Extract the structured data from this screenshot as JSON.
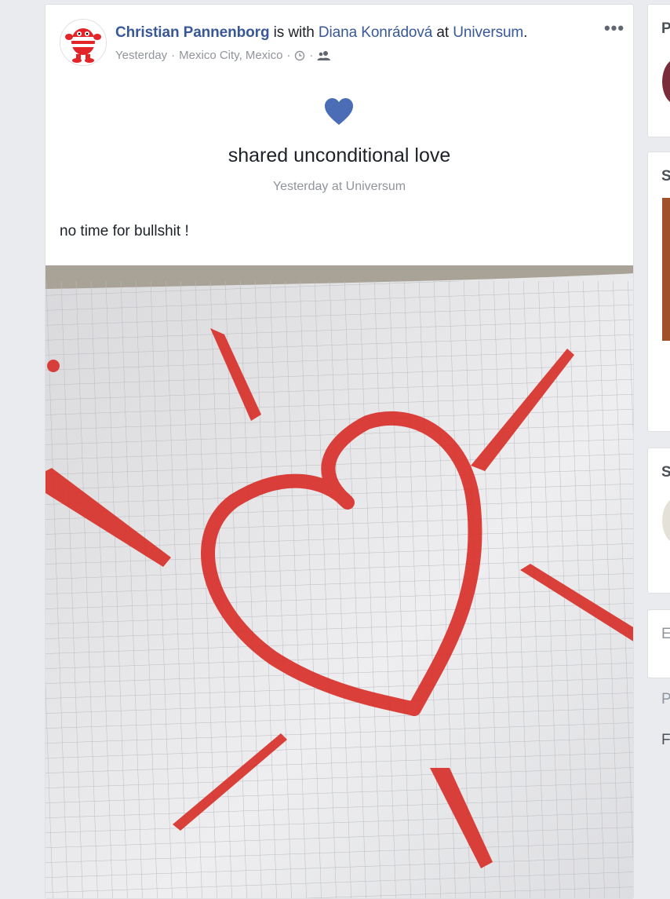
{
  "post": {
    "author": "Christian Pannenborg",
    "with_text": " is with ",
    "tagged": "Diana Konrádová",
    "at_text": " at ",
    "place": "Universum",
    "period": ".",
    "time": "Yesterday",
    "separator": "·",
    "location": "Mexico City, Mexico",
    "more_label": "•••",
    "feeling": "shared unconditional love",
    "feeling_meta": "Yesterday at Universum",
    "text": "no time for bullshit !",
    "photo_alt": "Red painted heart with rays on grid paper"
  },
  "icons": {
    "clock": "clock-icon",
    "audience": "friends-icon",
    "heart": "heart-icon"
  },
  "colors": {
    "link": "#385898",
    "heart": "#4a6db5",
    "meta": "#90949c",
    "paint": "#d8302a"
  },
  "sidebar": {
    "letters": [
      "P",
      "S",
      "S",
      "E",
      "P",
      "F"
    ]
  }
}
